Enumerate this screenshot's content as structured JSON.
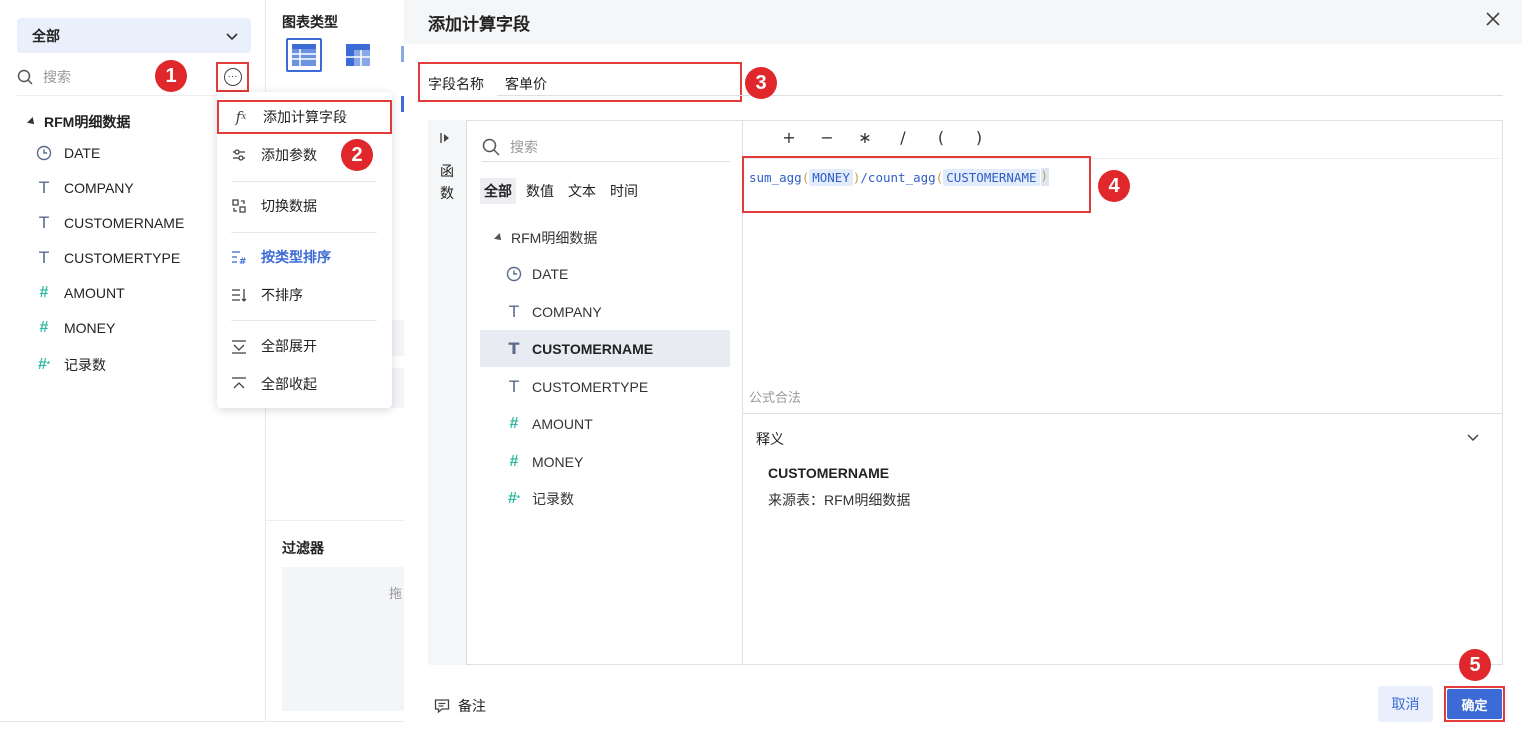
{
  "left": {
    "scope_select": "全部",
    "search_placeholder": "搜索",
    "tree_title": "RFM明细数据",
    "fields": [
      {
        "name": "DATE",
        "type": "date"
      },
      {
        "name": "COMPANY",
        "type": "text"
      },
      {
        "name": "CUSTOMERNAME",
        "type": "text"
      },
      {
        "name": "CUSTOMERTYPE",
        "type": "text"
      },
      {
        "name": "AMOUNT",
        "type": "number"
      },
      {
        "name": "MONEY",
        "type": "number"
      },
      {
        "name": "记录数",
        "type": "count"
      }
    ]
  },
  "menu": {
    "items": [
      {
        "label": "添加计算字段",
        "icon": "fx-icon"
      },
      {
        "label": "添加参数",
        "icon": "sliders-icon"
      },
      {
        "label": "切换数据",
        "icon": "switch-data-icon"
      },
      {
        "label": "按类型排序",
        "icon": "sort-by-type-icon"
      },
      {
        "label": "不排序",
        "icon": "no-sort-icon"
      },
      {
        "label": "全部展开",
        "icon": "expand-all-icon"
      },
      {
        "label": "全部收起",
        "icon": "collapse-all-icon"
      }
    ]
  },
  "badges": [
    "1",
    "2",
    "3",
    "4",
    "5"
  ],
  "middle": {
    "chart_type_title": "图表类型",
    "filter_title": "过滤器",
    "filter_drag_hint": "拖"
  },
  "dialog": {
    "title": "添加计算字段",
    "name_label": "字段名称",
    "name_value": "客单价",
    "fn_rail_label": "函数",
    "search_placeholder": "搜索",
    "tabs": [
      "全部",
      "数值",
      "文本",
      "时间"
    ],
    "tree_title": "RFM明细数据",
    "selected_field": "CUSTOMERNAME",
    "operators": [
      "+",
      "−",
      "∗",
      "/",
      "(",
      ")"
    ],
    "formula": {
      "fn1": "sum_agg",
      "arg1": "MONEY",
      "div": "/",
      "fn2": "count_agg",
      "arg2": "CUSTOMERNAME",
      "open": "(",
      "close": ")"
    },
    "formula_status": "公式合法",
    "explain_title": "释义",
    "explain_name": "CUSTOMERNAME",
    "explain_source": "来源表：RFM明细数据",
    "remark_label": "备注",
    "cancel_label": "取消",
    "ok_label": "确定"
  },
  "colors": {
    "accent": "#3d6bd6",
    "highlight_red": "#e23b3b",
    "number_field": "#2fb8a3"
  }
}
